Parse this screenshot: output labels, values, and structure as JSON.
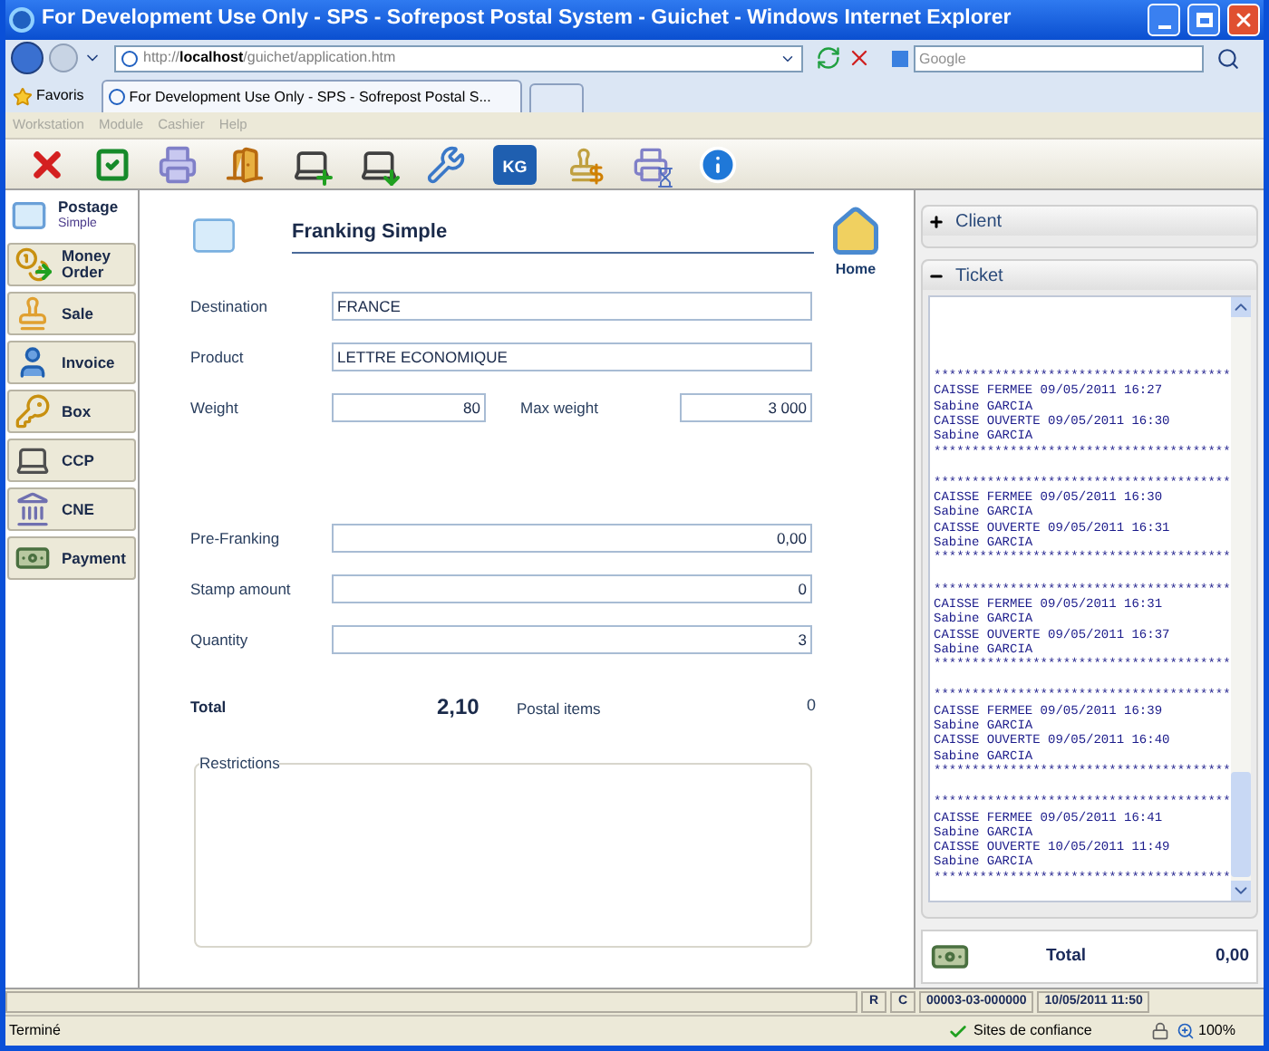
{
  "window": {
    "title": "For Development Use Only - SPS - Sofrepost Postal System - Guichet - Windows Internet Explorer"
  },
  "address_bar": {
    "url": "http://**localhost**/guichet/application.htm"
  },
  "search": {
    "placeholder": "Google"
  },
  "favorites": "Favoris",
  "tabs": [
    {
      "label": "For Development Use Only - SPS - Sofrepost Postal S...",
      "selected": true
    }
  ],
  "menu": [
    {
      "label": "Workstation",
      "disabled": true
    },
    {
      "label": "Module",
      "disabled": true
    },
    {
      "label": "Cashier",
      "disabled": true
    },
    {
      "label": "Help",
      "disabled": true
    }
  ],
  "toolbar": [
    {
      "kind": "delete"
    },
    {
      "kind": "validate"
    },
    {
      "kind": "print"
    },
    {
      "kind": "exit"
    },
    {
      "kind": "laptop-add"
    },
    {
      "kind": "laptop-download"
    },
    {
      "kind": "tools"
    },
    {
      "kind": "weight",
      "text": "KG"
    },
    {
      "kind": "stamp-price"
    },
    {
      "kind": "print-wait"
    },
    {
      "kind": "info"
    }
  ],
  "sidebar": {
    "items": [
      {
        "kind": "postage",
        "label": "Postage",
        "sublabel": "Simple",
        "selected": true
      },
      {
        "kind": "money-order",
        "label": "Money Order",
        "selected": false
      },
      {
        "kind": "sale",
        "label": "Sale",
        "selected": false
      },
      {
        "kind": "invoice",
        "label": "Invoice",
        "selected": false
      },
      {
        "kind": "box",
        "label": "Box",
        "selected": false
      },
      {
        "kind": "ccp",
        "label": "CCP",
        "selected": false
      },
      {
        "kind": "cne",
        "label": "CNE",
        "selected": false
      },
      {
        "kind": "payment",
        "label": "Payment",
        "selected": false
      }
    ]
  },
  "form": {
    "title": "Franking Simple",
    "home": "Home",
    "groups": [
      [
        [
          {
            "label": "Destination",
            "value": "FRANCE",
            "kind": "text"
          }
        ],
        [
          {
            "label": "Product",
            "value": "LETTRE ECONOMIQUE",
            "kind": "text"
          }
        ],
        [
          {
            "label": "Weight",
            "value": "80",
            "kind": "number"
          },
          {
            "label": "Max weight",
            "value": "3 000",
            "kind": "number"
          }
        ]
      ],
      [
        [
          {
            "label": "Pre-Franking",
            "value": "0,00",
            "kind": "number"
          }
        ],
        [
          {
            "label": "Stamp amount",
            "value": "0",
            "kind": "number"
          }
        ],
        [
          {
            "label": "Quantity",
            "value": "3",
            "kind": "number"
          }
        ]
      ]
    ],
    "total": {
      "label": "Total",
      "value": "2,10"
    },
    "postal_items": {
      "label": "Postal items",
      "value": "0"
    },
    "restrictions": {
      "legend": "Restrictions"
    }
  },
  "panels": [
    {
      "title": "Client",
      "expanded": false
    },
    {
      "title": "Ticket",
      "expanded": true,
      "blocks": [
        [
          "***************************************",
          "CAISSE FERMEE 09/05/2011 16:27",
          "Sabine GARCIA",
          "CAISSE OUVERTE 09/05/2011 16:30",
          "Sabine GARCIA",
          "***************************************"
        ],
        [
          "***************************************",
          "CAISSE FERMEE 09/05/2011 16:30",
          "Sabine GARCIA",
          "CAISSE OUVERTE 09/05/2011 16:31",
          "Sabine GARCIA",
          "***************************************"
        ],
        [
          "***************************************",
          "CAISSE FERMEE 09/05/2011 16:31",
          "Sabine GARCIA",
          "CAISSE OUVERTE 09/05/2011 16:37",
          "Sabine GARCIA",
          "***************************************"
        ],
        [
          "***************************************",
          "CAISSE FERMEE 09/05/2011 16:39",
          "Sabine GARCIA",
          "CAISSE OUVERTE 09/05/2011 16:40",
          "Sabine GARCIA",
          "***************************************"
        ],
        [
          "***************************************",
          "CAISSE FERMEE 09/05/2011 16:41",
          "Sabine GARCIA",
          "CAISSE OUVERTE 10/05/2011 11:49",
          "Sabine GARCIA",
          "***************************************"
        ]
      ]
    }
  ],
  "ticket_total": {
    "label": "Total",
    "value": "0,00"
  },
  "app_status": {
    "cells": [
      "R",
      "C",
      "00003-03-000000",
      "10/05/2011 11:50"
    ]
  },
  "status_bar": {
    "text": "Terminé",
    "zone": "Sites de confiance",
    "zoom": "100%"
  }
}
